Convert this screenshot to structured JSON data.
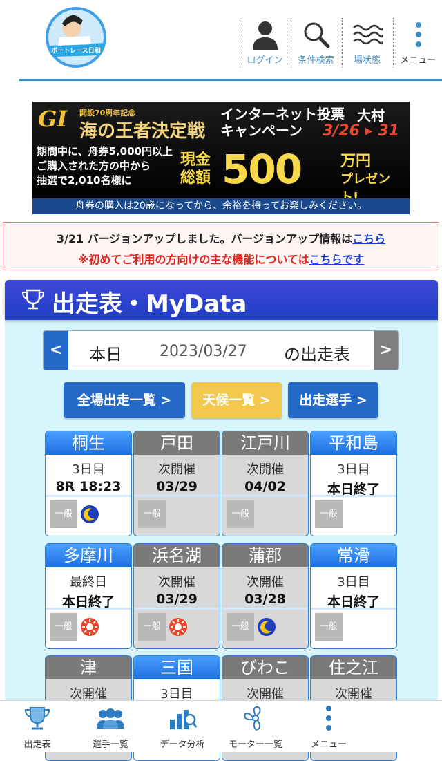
{
  "app": {
    "logo_text": "ボートレース日和"
  },
  "header": {
    "buttons": [
      {
        "label": "ログイン"
      },
      {
        "label": "条件検索"
      },
      {
        "label": "場状態"
      },
      {
        "label": "メニュー"
      }
    ]
  },
  "banner": {
    "gi": "GI",
    "subtitle": "開設70周年記念",
    "title": "海の王者決定戦",
    "campaign_line1": "インターネット投票",
    "campaign_line2": "キャンペーン",
    "venue": "大村",
    "dates": "3/26 ▸ 31",
    "left_line1": "期間中に、舟券5,000円以上",
    "left_line2": "ご購入された方の中から",
    "left_line3": "抽選で2,010名様に",
    "prize_small1": "現金",
    "prize_small2": "総額",
    "prize_big": "500",
    "prize_unit1": "万円",
    "prize_unit2": "プレゼント!",
    "footer": "舟券の購入は20歳になってから、余裕を持ってお楽しみください。"
  },
  "notice": {
    "line1_text": "3/21 バージョンアップしました。バージョンアップ情報は",
    "line1_link": "こちら",
    "line2_text": "※初めてご利用の方向けの主な機能については",
    "line2_link": "こちらです"
  },
  "panel": {
    "title": "出走表・MyData"
  },
  "datebar": {
    "prev": "<",
    "today": "本日",
    "date": "2023/03/27",
    "suffix": "の出走表",
    "next": ">"
  },
  "quick": [
    {
      "label": "全場出走一覧 >",
      "color": "#2468c8"
    },
    {
      "label": "天候一覧 >",
      "color": "#f2c94c"
    },
    {
      "label": "出走選手 >",
      "color": "#2468c8"
    }
  ],
  "venues": [
    {
      "name": "桐生",
      "line1": "3日目",
      "line2": "8R 18:23",
      "grade": "一般",
      "active": true,
      "weather": "moon"
    },
    {
      "name": "戸田",
      "line1": "次開催",
      "line2": "03/29",
      "grade": "一般",
      "active": false,
      "weather": ""
    },
    {
      "name": "江戸川",
      "line1": "次開催",
      "line2": "04/02",
      "grade": "一般",
      "active": false,
      "weather": ""
    },
    {
      "name": "平和島",
      "line1": "3日目",
      "line2": "本日終了",
      "grade": "一般",
      "active": true,
      "weather": ""
    },
    {
      "name": "多摩川",
      "line1": "最終日",
      "line2": "本日終了",
      "grade": "一般",
      "active": true,
      "weather": "sun"
    },
    {
      "name": "浜名湖",
      "line1": "次開催",
      "line2": "03/29",
      "grade": "一般",
      "active": false,
      "weather": "sun"
    },
    {
      "name": "蒲郡",
      "line1": "次開催",
      "line2": "03/28",
      "grade": "一般",
      "active": false,
      "weather": "moon"
    },
    {
      "name": "常滑",
      "line1": "3日目",
      "line2": "本日終了",
      "grade": "一般",
      "active": true,
      "weather": ""
    },
    {
      "name": "津",
      "line1": "次開催",
      "line2": "",
      "grade": "",
      "active": false,
      "weather": ""
    },
    {
      "name": "三国",
      "line1": "3日目",
      "line2": "",
      "grade": "",
      "active": true,
      "weather": ""
    },
    {
      "name": "びわこ",
      "line1": "次開催",
      "line2": "",
      "grade": "",
      "active": false,
      "weather": ""
    },
    {
      "name": "住之江",
      "line1": "次開催",
      "line2": "",
      "grade": "",
      "active": false,
      "weather": ""
    }
  ],
  "bottom_nav": [
    {
      "label": "出走表",
      "icon": "trophy-icon"
    },
    {
      "label": "選手一覧",
      "icon": "people-icon"
    },
    {
      "label": "データ分析",
      "icon": "chart-icon"
    },
    {
      "label": "モーター一覧",
      "icon": "propeller-icon"
    },
    {
      "label": "メニュー",
      "icon": "dots-icon"
    }
  ]
}
